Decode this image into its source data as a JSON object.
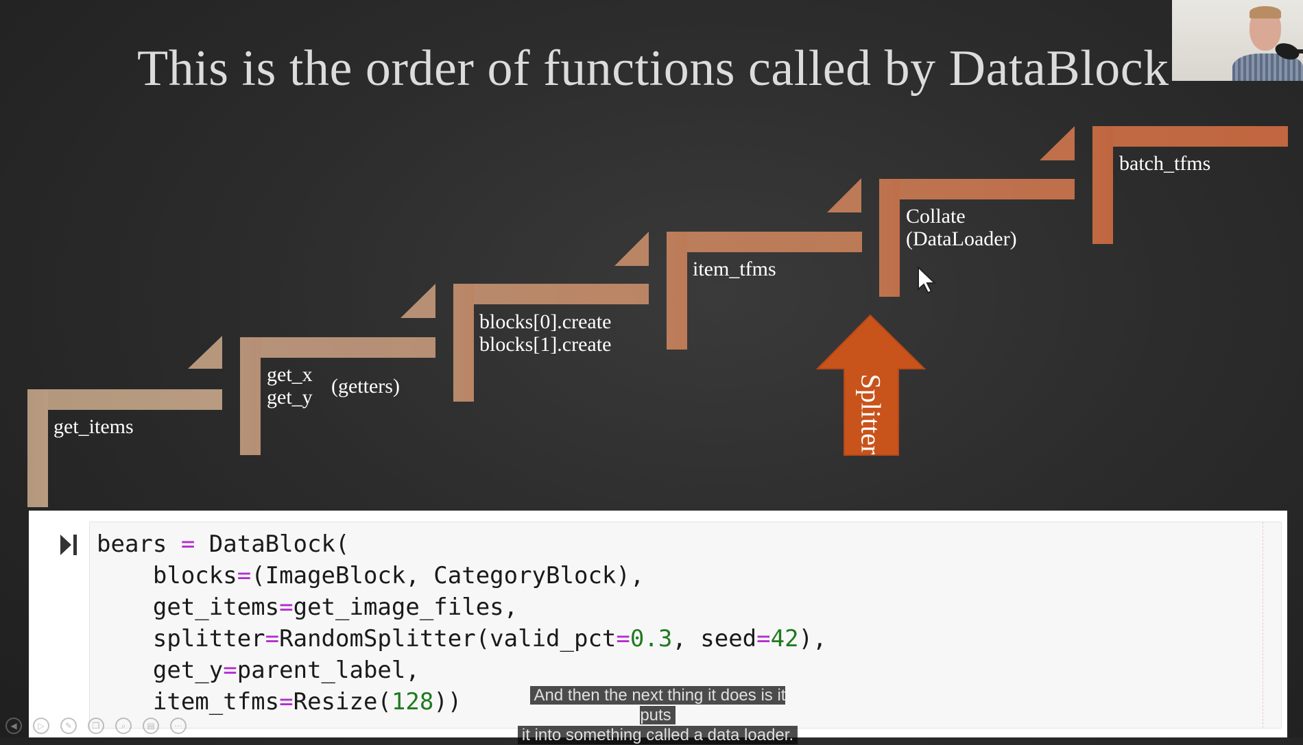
{
  "slide": {
    "title": "This is the order of functions called by DataBlock"
  },
  "steps": [
    {
      "lines": [
        "get_items"
      ]
    },
    {
      "lines": [
        "get_x",
        "get_y"
      ],
      "side_note": "(getters)"
    },
    {
      "lines": [
        "blocks[0].create",
        "blocks[1].create"
      ]
    },
    {
      "lines": [
        "item_tfms"
      ]
    },
    {
      "lines": [
        "Collate",
        "(DataLoader)"
      ]
    },
    {
      "lines": [
        "batch_tfms"
      ]
    }
  ],
  "splitter": {
    "label": "Splitter"
  },
  "colors": {
    "step_light": "#b89b80",
    "step_mid": "#c07b55",
    "step_dark": "#c0683f",
    "splitter": "#c8531b",
    "background": "#2a2a2a"
  },
  "notebook": {
    "run_icon": "run-cell-icon",
    "code_lines": [
      "bears = DataBlock(",
      "    blocks=(ImageBlock, CategoryBlock),",
      "    get_items=get_image_files,",
      "    splitter=RandomSplitter(valid_pct=0.3, seed=42),",
      "    get_y=parent_label,",
      "    item_tfms=Resize(128))"
    ]
  },
  "caption": {
    "line1": "And then the next thing it does is it puts",
    "line2": "it into something called a data loader."
  },
  "player_controls": [
    {
      "icon": "previous-icon",
      "glyph": "◀"
    },
    {
      "icon": "play-icon",
      "glyph": "▷"
    },
    {
      "icon": "pen-icon",
      "glyph": "✎"
    },
    {
      "icon": "copy-icon",
      "glyph": "❐"
    },
    {
      "icon": "zoom-icon",
      "glyph": "⌕"
    },
    {
      "icon": "subtitles-icon",
      "glyph": "▤"
    },
    {
      "icon": "more-icon",
      "glyph": "⋯"
    }
  ]
}
